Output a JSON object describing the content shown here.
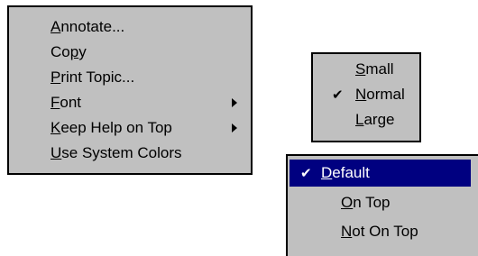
{
  "main_menu": {
    "items": [
      {
        "pre": "",
        "mn": "A",
        "post": "nnotate...",
        "submenu": false
      },
      {
        "pre": "Co",
        "mn": "p",
        "post": "y",
        "submenu": false
      },
      {
        "pre": "",
        "mn": "P",
        "post": "rint Topic...",
        "submenu": false
      },
      {
        "pre": "",
        "mn": "F",
        "post": "ont",
        "submenu": true
      },
      {
        "pre": "",
        "mn": "K",
        "post": "eep Help on Top",
        "submenu": true
      },
      {
        "pre": "",
        "mn": "U",
        "post": "se System Colors",
        "submenu": false
      }
    ]
  },
  "font_menu": {
    "items": [
      {
        "pre": "",
        "mn": "S",
        "post": "mall",
        "checked": false
      },
      {
        "pre": "",
        "mn": "N",
        "post": "ormal",
        "checked": true
      },
      {
        "pre": "",
        "mn": "L",
        "post": "arge",
        "checked": false
      }
    ]
  },
  "keep_on_top_menu": {
    "items": [
      {
        "pre": "",
        "mn": "D",
        "post": "efault",
        "checked": true,
        "selected": true
      },
      {
        "pre": "",
        "mn": "O",
        "post": "n Top",
        "checked": false,
        "selected": false
      },
      {
        "pre": "",
        "mn": "N",
        "post": "ot On Top",
        "checked": false,
        "selected": false
      }
    ]
  },
  "icons": {
    "check": "check-icon",
    "submenu_arrow": "submenu-arrow-icon"
  },
  "colors": {
    "menu_bg": "#c0c0c0",
    "highlight_bg": "#000080",
    "highlight_text": "#ffffff",
    "border": "#000000"
  }
}
